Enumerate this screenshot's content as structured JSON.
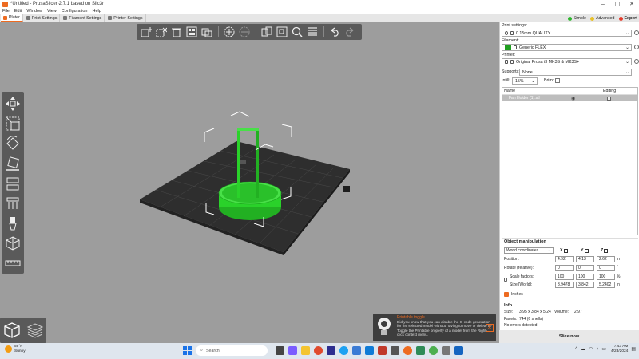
{
  "window": {
    "title": "*Untitled - PrusaSlicer-2.7.1 based on Slic3r"
  },
  "menu": [
    "File",
    "Edit",
    "Window",
    "View",
    "Configuration",
    "Help"
  ],
  "tabs": [
    {
      "label": "Plater",
      "active": true
    },
    {
      "label": "Print Settings",
      "active": false
    },
    {
      "label": "Filament Settings",
      "active": false
    },
    {
      "label": "Printer Settings",
      "active": false
    }
  ],
  "modes": [
    {
      "label": "Simple",
      "color": "#2fb62f"
    },
    {
      "label": "Advanced",
      "color": "#e8c12a"
    },
    {
      "label": "Expert",
      "color": "#e33b2b"
    }
  ],
  "sidebar": {
    "print_settings_label": "Print settings:",
    "print_settings_value": "0.15mm QUALITY",
    "filament_label": "Filament:",
    "filament_value": "Generic FLEX",
    "filament_color": "#1f9e1f",
    "printer_label": "Printer:",
    "printer_value": "Original Prusa i3 MK3S & MK3S+",
    "supports_label": "Supports:",
    "supports_value": "None",
    "infill_label": "Infill:",
    "infill_value": "15%",
    "brim_label": "Brim:",
    "objects": {
      "col_name": "Name",
      "col_editing": "Editing",
      "rows": [
        {
          "name": "Fan Holder (1).stl"
        }
      ]
    },
    "manipulation": {
      "title": "Object manipulation",
      "coord_system": "World coordinates",
      "position_label": "Position:",
      "rotate_label": "Rotate (relative):",
      "scale_label": "Scale factors:",
      "size_label": "Size [World]:",
      "axes": [
        "X",
        "Y",
        "Z"
      ],
      "position": [
        "4.92",
        "4.13",
        "2.62"
      ],
      "rotate": [
        "0",
        "0",
        "0"
      ],
      "scale": [
        "100",
        "100",
        "100"
      ],
      "size": [
        "3.9478",
        "3.842",
        "5.2402"
      ],
      "unit_in": "in",
      "unit_deg": "°",
      "unit_pct": "%",
      "inches_label": "Inches"
    },
    "info": {
      "title": "Info",
      "size_label": "Size:",
      "size_value": "3.95 x 3.84 x 5.24",
      "volume_label": "Volume:",
      "volume_value": "2.97",
      "facets_label": "Facets:",
      "facets_value": "744 (6 shells)",
      "errors": "No errors detected"
    },
    "slice_button": "Slice now"
  },
  "hint": {
    "title": "Printable toggle",
    "text": "Did you know that you can disable the G-code generation for the selected model without having to move or delete it? Toggle the Printable property of a model from the Right-click context menu."
  },
  "taskbar": {
    "temperature": "59°F",
    "weather": "Sunny",
    "search_placeholder": "Search",
    "time": "7:43 AM",
    "date": "4/23/2024"
  }
}
